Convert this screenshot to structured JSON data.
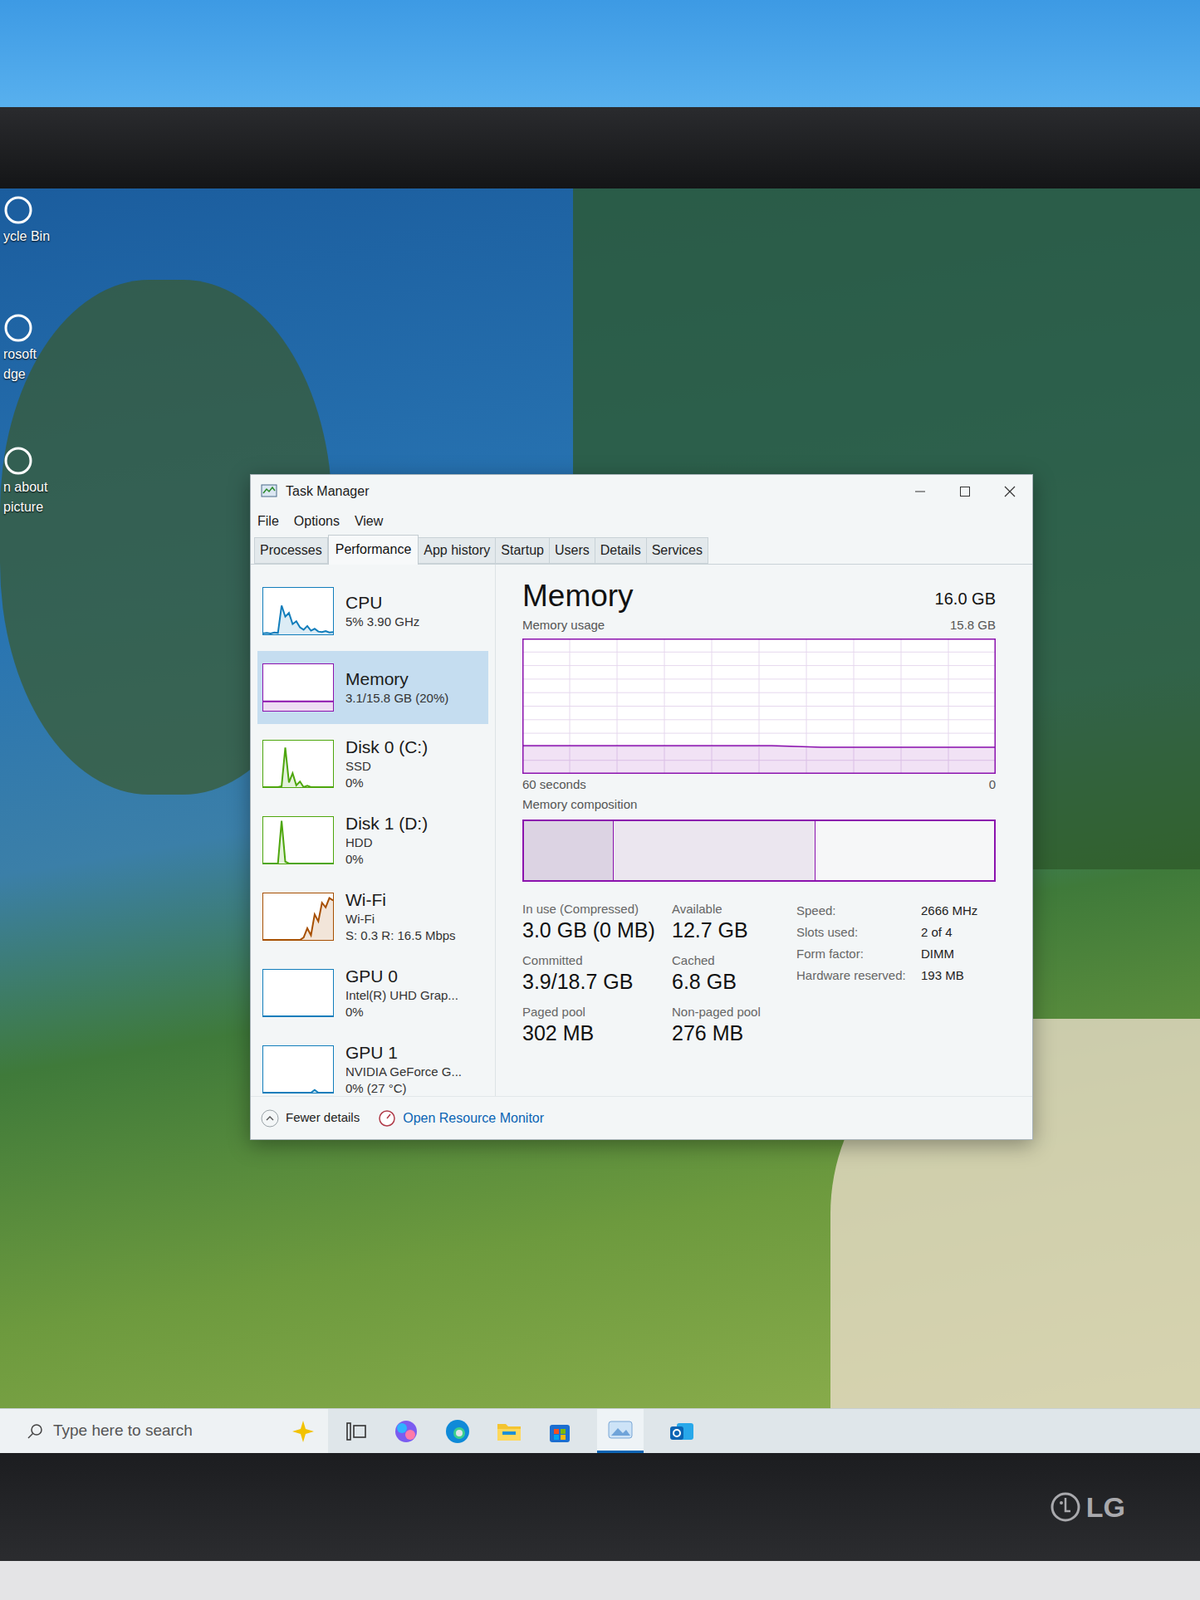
{
  "window": {
    "title": "Task Manager"
  },
  "menu": [
    "File",
    "Options",
    "View"
  ],
  "tabs": [
    {
      "label": "Processes",
      "selected": false
    },
    {
      "label": "Performance",
      "selected": true
    },
    {
      "label": "App history",
      "selected": false
    },
    {
      "label": "Startup",
      "selected": false
    },
    {
      "label": "Users",
      "selected": false
    },
    {
      "label": "Details",
      "selected": false
    },
    {
      "label": "Services",
      "selected": false
    }
  ],
  "desktop_icons": [
    {
      "lines": [
        "ycle Bin"
      ]
    },
    {
      "lines": [
        "rosoft",
        "dge"
      ]
    },
    {
      "lines": [
        "n about",
        "picture"
      ]
    }
  ],
  "sidebar": {
    "items": [
      {
        "name": "CPU",
        "detail": [
          "5% 3.90 GHz"
        ],
        "selected": false,
        "color": "#117dbb",
        "values": [
          2,
          3,
          2,
          4,
          3,
          62,
          38,
          46,
          22,
          28,
          15,
          10,
          18,
          8,
          12,
          6,
          5,
          7,
          4,
          5
        ]
      },
      {
        "name": "Memory",
        "detail": [
          "3.1/15.8 GB (20%)"
        ],
        "selected": true,
        "color": "#8b12ae",
        "values": [
          20,
          20,
          20,
          20,
          20,
          20,
          20,
          20,
          20,
          20,
          20,
          20,
          20,
          20,
          20,
          20,
          20,
          20,
          20,
          20
        ]
      },
      {
        "name": "Disk 0 (C:)",
        "detail": [
          "SSD",
          "0%"
        ],
        "selected": false,
        "color": "#4da60c",
        "values": [
          0,
          0,
          0,
          0,
          0,
          2,
          85,
          10,
          30,
          4,
          12,
          0,
          3,
          0,
          0,
          0,
          0,
          0,
          0,
          0
        ]
      },
      {
        "name": "Disk 1 (D:)",
        "detail": [
          "HDD",
          "0%"
        ],
        "selected": false,
        "color": "#4da60c",
        "values": [
          0,
          0,
          0,
          0,
          0,
          92,
          4,
          0,
          0,
          0,
          0,
          0,
          0,
          0,
          0,
          0,
          0,
          0,
          0,
          0
        ]
      },
      {
        "name": "Wi-Fi",
        "detail": [
          "Wi-Fi",
          "S: 0.3 R: 16.5 Mbps"
        ],
        "selected": false,
        "color": "#a74f01",
        "values": [
          0,
          0,
          0,
          0,
          0,
          0,
          0,
          0,
          0,
          0,
          0,
          5,
          25,
          10,
          55,
          40,
          80,
          70,
          90,
          85
        ]
      },
      {
        "name": "GPU 0",
        "detail": [
          "Intel(R) UHD Grap...",
          "0%"
        ],
        "selected": false,
        "color": "#117dbb",
        "values": [
          0,
          0,
          0,
          0,
          0,
          0,
          0,
          0,
          0,
          0,
          0,
          0,
          0,
          0,
          0,
          0,
          0,
          0,
          0,
          0
        ]
      },
      {
        "name": "GPU 1",
        "detail": [
          "NVIDIA GeForce G...",
          "0% (27 °C)"
        ],
        "selected": false,
        "color": "#117dbb",
        "values": [
          0,
          0,
          0,
          0,
          0,
          0,
          0,
          0,
          0,
          0,
          0,
          0,
          0,
          0,
          6,
          0,
          0,
          0,
          0,
          0
        ]
      }
    ]
  },
  "memory": {
    "title": "Memory",
    "total": "16.0 GB",
    "usage_label": "Memory usage",
    "axis_max_label": "15.8 GB",
    "axis_max": 15.8,
    "usage_values": [
      3.3,
      3.3,
      3.3,
      3.3,
      3.3,
      3.3,
      3.3,
      3.3,
      3.3,
      3.3,
      3.3,
      3.2,
      3.1,
      3.1,
      3.1,
      3.1,
      3.1,
      3.1,
      3.1,
      3.1
    ],
    "time_label": "60 seconds",
    "zero_label": "0",
    "composition_label": "Memory composition",
    "composition": [
      {
        "name": "in-use",
        "level": 0.19,
        "color": "#dcd3e3"
      },
      {
        "name": "standby",
        "level": 0.43,
        "color": "#ebe6ef"
      },
      {
        "name": "free",
        "level": 0.38,
        "color": "#f6f7f8"
      }
    ],
    "stats": [
      {
        "label": "In use (Compressed)",
        "value": "3.0 GB (0 MB)"
      },
      {
        "label": "Available",
        "value": "12.7 GB"
      },
      {
        "label": "Committed",
        "value": "3.9/18.7 GB"
      },
      {
        "label": "Cached",
        "value": "6.8 GB"
      },
      {
        "label": "Paged pool",
        "value": "302 MB"
      },
      {
        "label": "Non-paged pool",
        "value": "276 MB"
      }
    ],
    "specs": [
      {
        "label": "Speed:",
        "value": "2666 MHz"
      },
      {
        "label": "Slots used:",
        "value": "2 of 4"
      },
      {
        "label": "Form factor:",
        "value": "DIMM"
      },
      {
        "label": "Hardware reserved:",
        "value": "193 MB"
      }
    ]
  },
  "footer": {
    "fewer_details": "Fewer details",
    "resource_monitor": "Open Resource Monitor"
  },
  "taskbar": {
    "search_placeholder": "Type here to search"
  },
  "monitor": {
    "brand": "LG"
  }
}
